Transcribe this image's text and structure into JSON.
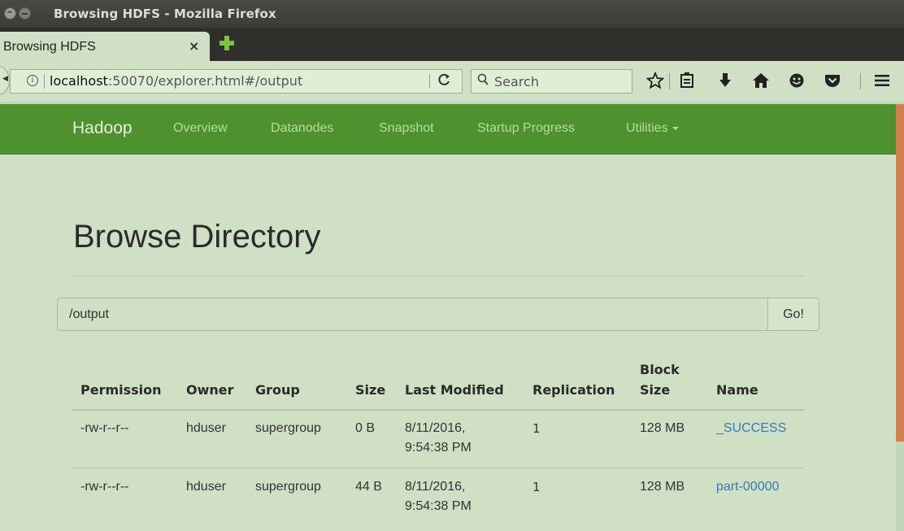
{
  "window": {
    "title": "Browsing HDFS - Mozilla Firefox"
  },
  "tab": {
    "title": "Browsing HDFS",
    "close_glyph": "×"
  },
  "navbar": {
    "url_host": "localhost",
    "url_rest": ":50070/explorer.html#/output",
    "search_placeholder": "Search",
    "reload_glyph": "C",
    "icons": [
      "star-icon",
      "reading-list-icon",
      "download-icon",
      "home-icon",
      "hello-icon",
      "pocket-icon",
      "menu-icon"
    ]
  },
  "site_nav": {
    "brand": "Hadoop",
    "links": [
      "Overview",
      "Datanodes",
      "Snapshot",
      "Startup Progress",
      "Utilities"
    ],
    "bar_color": "#4e9230"
  },
  "main": {
    "heading": "Browse Directory",
    "path_value": "/output",
    "go_label": "Go!"
  },
  "table": {
    "headers": {
      "permission": "Permission",
      "owner": "Owner",
      "group": "Group",
      "size": "Size",
      "last_modified": "Last Modified",
      "replication": "Replication",
      "block_size_1": "Block",
      "block_size_2": "Size",
      "name": "Name"
    },
    "rows": [
      {
        "permission": "-rw-r--r--",
        "owner": "hduser",
        "group": "supergroup",
        "size": "0 B",
        "last_modified_1": "8/11/2016,",
        "last_modified_2": "9:54:38 PM",
        "replication": "1",
        "block_size": "128 MB",
        "name": "_SUCCESS"
      },
      {
        "permission": "-rw-r--r--",
        "owner": "hduser",
        "group": "supergroup",
        "size": "44 B",
        "last_modified_1": "8/11/2016,",
        "last_modified_2": "9:54:38 PM",
        "replication": "1",
        "block_size": "128 MB",
        "name": "part-00000"
      }
    ]
  },
  "colors": {
    "page_bg": "#cfe0c4",
    "link": "#3a7ab0",
    "scroll_thumb": "#d47f4e"
  }
}
